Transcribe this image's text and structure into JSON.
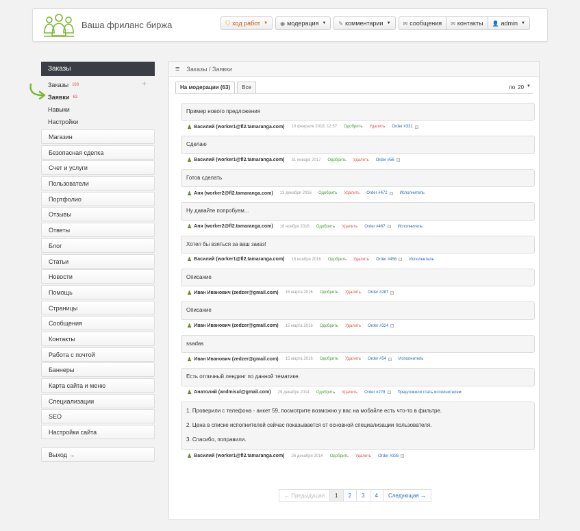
{
  "header": {
    "site_title": "Ваша фриланс биржа",
    "nav": {
      "progress": "ход работ",
      "moderation": "модерация",
      "comments": "комментарии",
      "messages": "сообщения",
      "contacts": "контакты",
      "user": "admin"
    }
  },
  "sidebar": {
    "section_title": "Заказы",
    "sub_items": [
      {
        "label": "Заказы",
        "count": "168"
      },
      {
        "label": "Заявки",
        "count": "63"
      },
      {
        "label": "Навыки",
        "count": ""
      },
      {
        "label": "Настройки",
        "count": ""
      }
    ],
    "menu": [
      "Магазин",
      "Безопасная сделка",
      "Счет и услуги",
      "Пользователи",
      "Портфолио",
      "Отзывы",
      "Ответы",
      "Блог",
      "Статьи",
      "Новости",
      "Помощь",
      "Страницы",
      "Сообщения",
      "Контакты",
      "Работа с почтой",
      "Баннеры",
      "Карта сайта и меню",
      "Специализации",
      "SEO",
      "Настройки сайта"
    ],
    "exit": "Выход →"
  },
  "main": {
    "breadcrumb": "Заказы / Заявки",
    "tabs": [
      {
        "label": "На модерации (63)",
        "active": true
      },
      {
        "label": "Все",
        "active": false
      }
    ],
    "perpage_label": "по",
    "perpage_value": "20",
    "approve_label": "Одобрить",
    "delete_label": "Удалить",
    "items": [
      {
        "text": [
          "Пример нового предложения"
        ],
        "user": "Василий (worker1@fl2.tamaranga.com)",
        "date": "10 февраля 2018, 12:57",
        "order": "Order #331",
        "extra": ""
      },
      {
        "text": [
          "Сделаю"
        ],
        "user": "Василий (worker1@fl2.tamaranga.com)",
        "date": "31 января 2017",
        "order": "Order #56",
        "extra": ""
      },
      {
        "text": [
          "Готов сделать"
        ],
        "user": "Аня (worker2@fl2.tamaranga.com)",
        "date": "13 декабря 2016",
        "order": "Order #472",
        "extra": "Исполнитель"
      },
      {
        "text": [
          "Ну давайте попробуем..."
        ],
        "user": "Аня (worker2@fl2.tamaranga.com)",
        "date": "16 ноября 2016",
        "order": "Order #467",
        "extra": "Исполнитель"
      },
      {
        "text": [
          "Хотел бы взяться за ваш заказ!"
        ],
        "user": "Василий (worker1@fl2.tamaranga.com)",
        "date": "16 ноября 2016",
        "order": "Order #456",
        "extra": "Исполнитель"
      },
      {
        "text": [
          "Описание"
        ],
        "user": "Иван Иванович (zedzer@gmail.com)",
        "date": "15 марта 2016",
        "order": "Order #287",
        "extra": ""
      },
      {
        "text": [
          "Описание"
        ],
        "user": "Иван Иванович (zedzer@gmail.com)",
        "date": "15 марта 2016",
        "order": "Order #324",
        "extra": ""
      },
      {
        "text": [
          "ssadas"
        ],
        "user": "Иван Иванович (zedzer@gmail.com)",
        "date": "15 марта 2016",
        "order": "Order #54",
        "extra": "Исполнитель"
      },
      {
        "text": [
          "Есть отличный лендинг по данной тематике."
        ],
        "user": "Анатолий (andmisul@gmail.com)",
        "date": "29 декабря 2014",
        "order": "Order #278",
        "extra": "Предложили стать исполнителем"
      },
      {
        "text": [
          "1. Проверили с телефона - анкет 59, посмотрите возможно у вас на мобайле есть что-то в фильтре.",
          "2. Цена в списке исполнителей сейчас показывается от основной специализации пользователя.",
          "3. Спасибо, поправили."
        ],
        "user": "Василий (worker1@fl2.tamaranga.com)",
        "date": "26 декабря 2014",
        "order": "Order #335",
        "extra": ""
      }
    ],
    "pager": {
      "prev": "← Предыдущая",
      "pages": [
        "1",
        "2",
        "3",
        "4"
      ],
      "current": "1",
      "next": "Следующая →"
    }
  },
  "colors": {
    "accent_green": "#7ab833",
    "sidebar_dark": "#3a3e44",
    "approve": "#4a9a3a",
    "delete": "#d9534f",
    "link": "#2a6ab0"
  }
}
